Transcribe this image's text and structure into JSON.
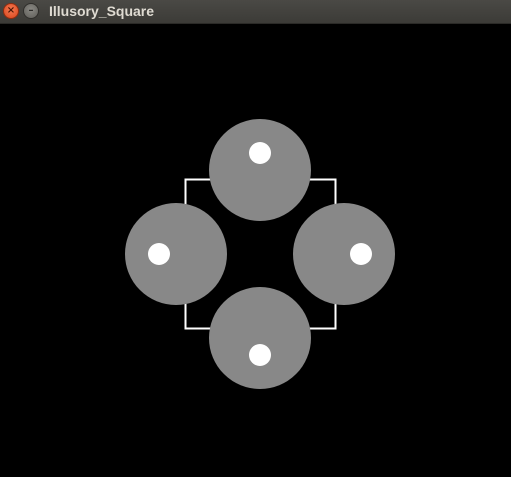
{
  "window": {
    "title": "Illusory_Square",
    "close_icon": "close-icon",
    "minimize_icon": "minimize-icon"
  },
  "colors": {
    "background": "#000000",
    "disc": "#888888",
    "dot": "#ffffff",
    "square_outline": "#ffffff",
    "titlebar": "#3c3b37",
    "title_text": "#dfdbd2"
  },
  "scene": {
    "discs": [
      {
        "name": "top-disc"
      },
      {
        "name": "left-disc"
      },
      {
        "name": "right-disc"
      },
      {
        "name": "bottom-disc"
      }
    ]
  }
}
